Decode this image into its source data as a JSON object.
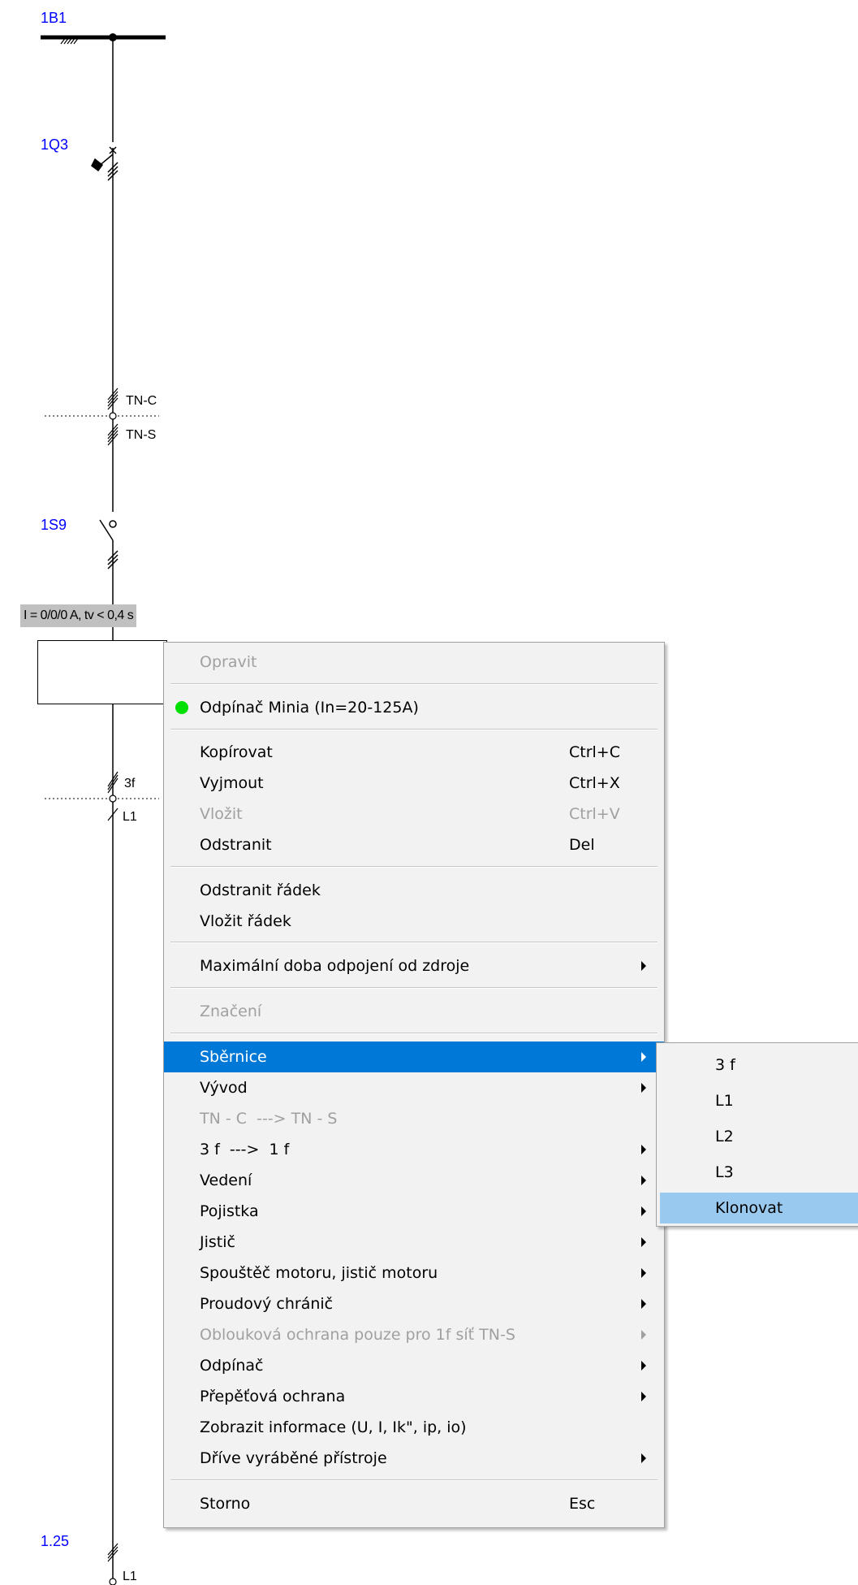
{
  "schematic": {
    "labels": {
      "bus": "1B1",
      "breaker": "1Q3",
      "switch": "1S9",
      "bottom": "1.25"
    },
    "tags": {
      "tnc": "TN-C",
      "tns": "TN-S",
      "phase3": "3f",
      "l1_mid": "L1",
      "l1_bottom": "L1"
    },
    "info_box": "I = 0/0/0 A, tv < 0,4 s"
  },
  "context_menu": {
    "items": [
      {
        "label": "Opravit",
        "disabled": true
      },
      {
        "label": "Odpínač Minia (In=20-125A)",
        "icon": "green-status-dot"
      },
      {
        "label": "Kopírovat",
        "shortcut": "Ctrl+C"
      },
      {
        "label": "Vyjmout",
        "shortcut": "Ctrl+X"
      },
      {
        "label": "Vložit",
        "shortcut": "Ctrl+V",
        "disabled": true
      },
      {
        "label": "Odstranit",
        "shortcut": "Del"
      },
      {
        "label": "Odstranit řádek"
      },
      {
        "label": "Vložit řádek"
      },
      {
        "label": "Maximální doba odpojení od zdroje",
        "submenu": true
      },
      {
        "label": "Značení",
        "disabled": true
      },
      {
        "label": "Sběrnice",
        "submenu": true,
        "highlighted": true
      },
      {
        "label": "Vývod",
        "submenu": true
      },
      {
        "label": "TN - C  ---> TN - S",
        "disabled": true
      },
      {
        "label": "3 f  --->  1 f",
        "submenu": true
      },
      {
        "label": "Vedení",
        "submenu": true
      },
      {
        "label": "Pojistka",
        "submenu": true
      },
      {
        "label": "Jistič",
        "submenu": true
      },
      {
        "label": "Spouštěč motoru, jistič motoru",
        "submenu": true
      },
      {
        "label": "Proudový chránič",
        "submenu": true
      },
      {
        "label": "Oblouková ochrana pouze pro 1f síť TN-S",
        "submenu": true,
        "disabled": true
      },
      {
        "label": "Odpínač",
        "submenu": true
      },
      {
        "label": "Přepěťová ochrana",
        "submenu": true
      },
      {
        "label": "Zobrazit informace (U, I, Ik\", ip, io)"
      },
      {
        "label": "Dříve vyráběné přístroje",
        "submenu": true
      },
      {
        "label": "Storno",
        "shortcut": "Esc"
      }
    ]
  },
  "submenu": {
    "items": [
      {
        "label": "3 f"
      },
      {
        "label": "L1"
      },
      {
        "label": "L2"
      },
      {
        "label": "L3"
      },
      {
        "label": "Klonovat",
        "highlighted": true
      }
    ]
  },
  "colors": {
    "label_blue": "#0000ff",
    "highlight": "#0078d7",
    "submenu_highlight": "#99c9ef",
    "status_dot": "#00e000"
  }
}
